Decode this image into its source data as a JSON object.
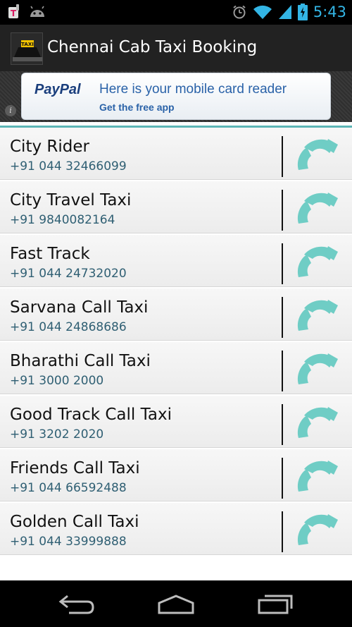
{
  "status_bar": {
    "time": "5:43",
    "left_icons": [
      "t-mobile-icon",
      "android-icon"
    ],
    "right_icons": [
      "alarm-icon",
      "wifi-icon",
      "signal-icon",
      "battery-icon"
    ]
  },
  "action_bar": {
    "title": "Chennai Cab Taxi Booking",
    "logo": "taxi-sign-icon"
  },
  "ad": {
    "brand": "PayPal",
    "headline": "Here is your mobile card reader",
    "cta": "Get the free app",
    "info_glyph": "i"
  },
  "contacts": [
    {
      "name": "City Rider",
      "phone": "+91 044 32466099"
    },
    {
      "name": "City Travel Taxi",
      "phone": "+91 9840082164"
    },
    {
      "name": "Fast Track",
      "phone": "+91 044 24732020"
    },
    {
      "name": "Sarvana Call Taxi",
      "phone": "+91 044 24868686"
    },
    {
      "name": "Bharathi Call Taxi",
      "phone": "+91 3000 2000"
    },
    {
      "name": "Good Track Call Taxi",
      "phone": "+91 3202 2020"
    },
    {
      "name": "Friends Call Taxi",
      "phone": "+91 044 66592488"
    },
    {
      "name": "Golden Call Taxi",
      "phone": " +91 044 33999888"
    }
  ],
  "colors": {
    "accent": "#33b5e5",
    "call_icon": "#6fcdc5",
    "divider": "#5db6b6"
  },
  "nav": [
    "back-icon",
    "home-icon",
    "recent-apps-icon"
  ]
}
